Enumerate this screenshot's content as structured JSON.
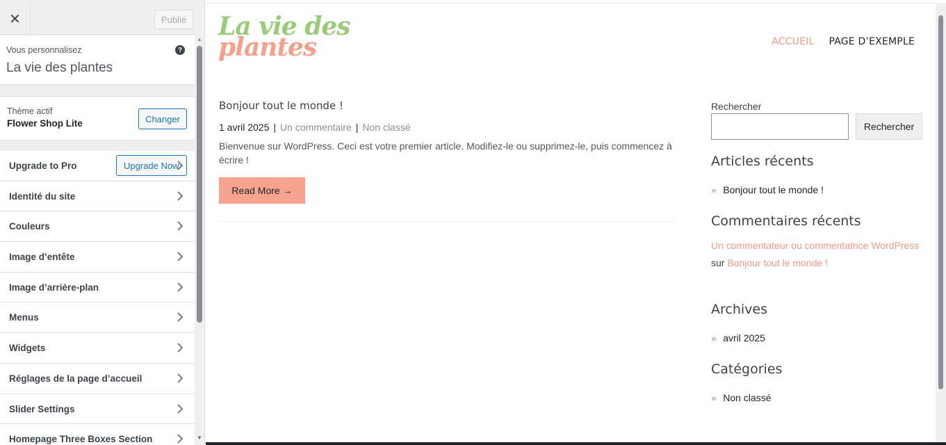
{
  "sidebar": {
    "close_glyph": "✕",
    "publish_label": "Publié",
    "customizing_label": "Vous personnalisez",
    "site_name": "La vie des plantes",
    "help_glyph": "?",
    "active_theme_label": "Thème actif",
    "theme_name": "Flower Shop Lite",
    "change_label": "Changer",
    "upgrade_now_label": "Upgrade Now",
    "sections": [
      {
        "label": "Upgrade to Pro"
      },
      {
        "label": "Identité du site"
      },
      {
        "label": "Couleurs"
      },
      {
        "label": "Image d’entête"
      },
      {
        "label": "Image d’arrière-plan"
      },
      {
        "label": "Menus"
      },
      {
        "label": "Widgets"
      },
      {
        "label": "Réglages de la page d’accueil"
      },
      {
        "label": "Slider Settings"
      },
      {
        "label": "Homepage Three Boxes Section"
      }
    ]
  },
  "site": {
    "logo_line1": "La vie des",
    "logo_line2": "plantes",
    "nav": {
      "home": "ACCUEIL",
      "sample": "PAGE D’EXEMPLE"
    },
    "post": {
      "title": "Bonjour tout le monde !",
      "date": "1 avril 2025",
      "separator": "|",
      "comments": "Un commentaire",
      "category": "Non classé",
      "excerpt": "Bienvenue sur WordPress. Ceci est votre premier article. Modifiez-le ou supprimez-le, puis commencez à écrire !",
      "read_more": "Read More →"
    },
    "widgets": {
      "search_label": "Rechercher",
      "search_button": "Rechercher",
      "recent_posts_title": "Articles récents",
      "recent_posts": [
        "Bonjour tout le monde !"
      ],
      "recent_comments_title": "Commentaires récents",
      "comment_author": "Un commentateur ou commentatrice WordPress",
      "comment_on": "sur",
      "comment_post": "Bonjour tout le monde !",
      "archives_title": "Archives",
      "archives": [
        "avril 2025"
      ],
      "categories_title": "Catégories",
      "categories": [
        "Non classé"
      ],
      "bullet_glyph": "»"
    }
  },
  "colors": {
    "accent_salmon": "#f6a390",
    "logo_green": "#9acb7b",
    "wp_blue": "#2271b1"
  }
}
